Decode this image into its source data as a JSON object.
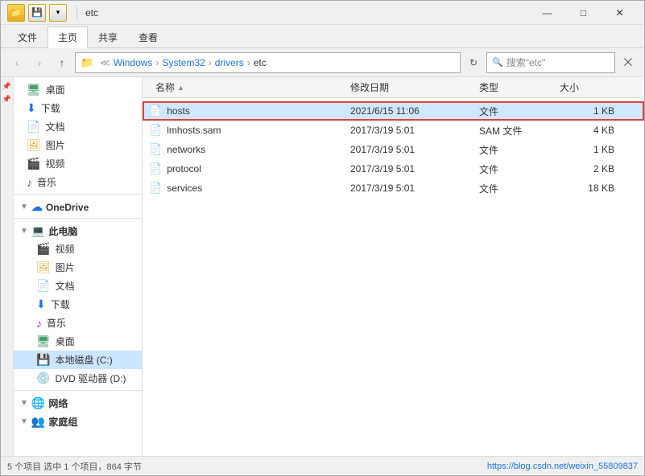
{
  "window": {
    "title": "etc",
    "title_prefix": "▾ etc"
  },
  "title_bar": {
    "icons": [
      "folder",
      "save",
      "arrow"
    ],
    "title": "etc",
    "minimize": "—",
    "maximize": "□",
    "close": "✕"
  },
  "ribbon": {
    "tabs": [
      "文件",
      "主页",
      "共享",
      "查看"
    ],
    "active_tab": "主页"
  },
  "address": {
    "path_parts": [
      "Windows",
      "System32",
      "drivers",
      "etc"
    ],
    "separator": "›",
    "search_placeholder": "搜索\"etc\""
  },
  "nav": {
    "back": "‹",
    "forward": "›",
    "up": "↑"
  },
  "sidebar": {
    "items": [
      {
        "id": "desktop",
        "label": "桌面",
        "icon": "🖥",
        "icon_type": "desktop"
      },
      {
        "id": "download",
        "label": "下载",
        "icon": "⬇",
        "icon_type": "download"
      },
      {
        "id": "docs",
        "label": "文档",
        "icon": "📄",
        "icon_type": "docs"
      },
      {
        "id": "pics",
        "label": "图片",
        "icon": "🖼",
        "icon_type": "pics"
      },
      {
        "id": "videos",
        "label": "视频",
        "icon": "🎬",
        "icon_type": "videos"
      },
      {
        "id": "music",
        "label": "音乐",
        "icon": "♪",
        "icon_type": "music"
      },
      {
        "id": "onedrive",
        "label": "OneDrive",
        "icon": "☁",
        "icon_type": "onedrive",
        "is_header": true
      },
      {
        "id": "computer",
        "label": "此电脑",
        "icon": "💻",
        "icon_type": "computer",
        "is_header": true
      },
      {
        "id": "videos2",
        "label": "视频",
        "icon": "🎬",
        "icon_type": "videos",
        "indent": true
      },
      {
        "id": "pics2",
        "label": "图片",
        "icon": "🖼",
        "icon_type": "pics",
        "indent": true
      },
      {
        "id": "docs2",
        "label": "文档",
        "icon": "📄",
        "icon_type": "docs",
        "indent": true
      },
      {
        "id": "download2",
        "label": "下载",
        "icon": "⬇",
        "icon_type": "download",
        "indent": true
      },
      {
        "id": "music2",
        "label": "音乐",
        "icon": "♪",
        "icon_type": "music",
        "indent": true
      },
      {
        "id": "desktop2",
        "label": "桌面",
        "icon": "🖥",
        "icon_type": "desktop",
        "indent": true
      },
      {
        "id": "local_disk",
        "label": "本地磁盘 (C:)",
        "icon": "💾",
        "icon_type": "disk",
        "indent": true,
        "selected": true
      },
      {
        "id": "dvd",
        "label": "DVD 驱动器 (D:)",
        "icon": "💿",
        "icon_type": "dvd",
        "indent": true
      },
      {
        "id": "network",
        "label": "网络",
        "icon": "🌐",
        "icon_type": "network",
        "is_header": true
      },
      {
        "id": "homegroup",
        "label": "家庭组",
        "icon": "👥",
        "icon_type": "homegroup",
        "is_header": true
      }
    ]
  },
  "file_list": {
    "columns": [
      {
        "id": "name",
        "label": "名称",
        "sort_arrow": "▲"
      },
      {
        "id": "date",
        "label": "修改日期"
      },
      {
        "id": "type",
        "label": "类型"
      },
      {
        "id": "size",
        "label": "大小"
      }
    ],
    "files": [
      {
        "id": "hosts",
        "name": "hosts",
        "date": "2021/6/15 11:06",
        "type": "文件",
        "size": "1 KB",
        "selected": true,
        "highlighted": true
      },
      {
        "id": "lmhosts",
        "name": "lmhosts.sam",
        "date": "2017/3/19 5:01",
        "type": "SAM 文件",
        "size": "4 KB"
      },
      {
        "id": "networks",
        "name": "networks",
        "date": "2017/3/19 5:01",
        "type": "文件",
        "size": "1 KB"
      },
      {
        "id": "protocol",
        "name": "protocol",
        "date": "2017/3/19 5:01",
        "type": "文件",
        "size": "2 KB"
      },
      {
        "id": "services",
        "name": "services",
        "date": "2017/3/19 5:01",
        "type": "文件",
        "size": "18 KB"
      }
    ]
  },
  "status_bar": {
    "text": "5 个项目  选中 1 个项目，864 字节",
    "watermark": "https://blog.csdn.net/weixin_55809837"
  }
}
